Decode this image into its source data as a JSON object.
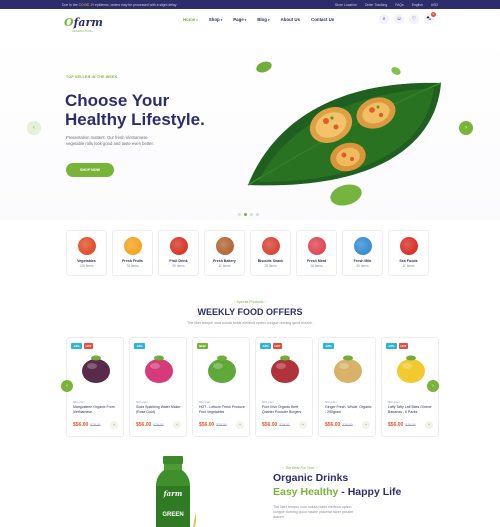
{
  "topbar": {
    "notice_prefix": "Due to the",
    "notice_highlight": "COVID 19",
    "notice_suffix": "epidemic, orders may be processed with a slight delay",
    "links": [
      "Store Location",
      "Order Tracking",
      "FAQs",
      "English",
      "USD"
    ]
  },
  "header": {
    "logo_main": "farm",
    "logo_initial": "O",
    "logo_tag": "ORGANIC FOOD",
    "nav": [
      {
        "label": "Home"
      },
      {
        "label": "Shop"
      },
      {
        "label": "Page"
      },
      {
        "label": "Blog"
      },
      {
        "label": "About Us"
      },
      {
        "label": "Contact Us"
      }
    ],
    "icons": [
      "search-icon",
      "user-icon",
      "heart-icon",
      "cart-icon"
    ],
    "cart_count": "0"
  },
  "hero": {
    "kicker": "TOP SELLER IN THE WEEK",
    "title_line1": "Choose Your",
    "title_line2": "Healthy Lifestyle.",
    "description": "Presentation matters. Our fresh Vietnamese vegetable rolls look good and taste even better.",
    "cta": "SHOP NOW",
    "slide_count": 4,
    "active_slide": 2
  },
  "categories": [
    {
      "name": "Vegetables",
      "count": "126 Items",
      "color": "#e0532f"
    },
    {
      "name": "Fresh Fruits",
      "count": "78 Items",
      "color": "#f5a623"
    },
    {
      "name": "Fruit Drink",
      "count": "99 Items",
      "color": "#d63b2c"
    },
    {
      "name": "Fresh Bakery",
      "count": "11 Items",
      "color": "#b56a3a"
    },
    {
      "name": "Biscuits Snack",
      "count": "25 Items",
      "color": "#d9473b"
    },
    {
      "name": "Fresh Meat",
      "count": "16 Items",
      "color": "#e04b55"
    },
    {
      "name": "Fresh Milk",
      "count": "30 Items",
      "color": "#3a8fd6"
    },
    {
      "name": "Sea Foods",
      "count": "11 Items",
      "color": "#d9352b"
    }
  ],
  "weekly": {
    "kicker": "~ Special Products ~",
    "title": "WEEKLY FOOD OFFERS",
    "subtitle": "The liber tempor cum soluta nobis eleifend option congue doming quod mazim.",
    "products": [
      {
        "tags": [
          "-18%",
          "HOT"
        ],
        "weight": "500 gram",
        "name": "Mangosteen Organic From VietNamese",
        "price": "$56.00",
        "old": "$79.00",
        "art": "#5a2a4a"
      },
      {
        "tags": [
          "-18%"
        ],
        "weight": "500 gram",
        "name": "Soda Sparkling Water Maker (Rose Gold)",
        "price": "$56.00",
        "old": "$79.00",
        "art": "#d63a7a"
      },
      {
        "tags": [
          "NEW"
        ],
        "weight": "500 gram",
        "name": "HOT - Lettuce Fresh Produce Fruit Vegetables",
        "price": "$56.00",
        "old": "$79.00",
        "art": "#5fa83a"
      },
      {
        "tags": [
          "-18%",
          "HOT"
        ],
        "weight": "500 gram",
        "name": "Pure Irish Organic Beef Quarter Pounder Burgers",
        "price": "$56.00",
        "old": "$79.00",
        "art": "#b0323a"
      },
      {
        "tags": [
          "-18%"
        ],
        "weight": "500 gram",
        "name": "Ginger Fresh, Whole, Organic - 250gram",
        "price": "$56.00",
        "old": "$79.00",
        "art": "#d9b26a"
      },
      {
        "tags": [
          "-18%",
          "HOT"
        ],
        "weight": "500 gram",
        "name": "Laffy Taffy Laff Bites Gimme Bananas - 6 Packs",
        "price": "$56.00",
        "old": "$79.00",
        "art": "#f2c92e"
      }
    ]
  },
  "drinks": {
    "kicker": "~ The Best For Your ~",
    "title_line1": "Organic Drinks",
    "title_green": "Easy Healthy",
    "title_rest": " - Happy Life",
    "description": "The liber tempor cum soluta nobis eleifend option congue doming quod mazim placerat facer possim assum.",
    "bottle_label": "farm",
    "bottle_sub": "GREEN"
  }
}
